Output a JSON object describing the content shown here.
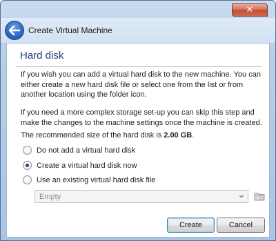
{
  "window": {
    "close_glyph": "✕",
    "title": "Create Virtual Machine"
  },
  "page": {
    "heading": "Hard disk",
    "paragraph1": "If you wish you can add a virtual hard disk to the new machine. You can either create a new hard disk file or select one from the list or from another location using the folder icon.",
    "paragraph2": "If you need a more complex storage set-up you can skip this step and make the changes to the machine settings once the machine is created.",
    "recommended_prefix": "The recommended size of the hard disk is ",
    "recommended_size": "2.00 GB",
    "recommended_suffix": "."
  },
  "options": [
    {
      "label": "Do not add a virtual hard disk",
      "selected": false
    },
    {
      "label": "Create a virtual hard disk now",
      "selected": true
    },
    {
      "label": "Use an existing virtual hard disk file",
      "selected": false
    }
  ],
  "existing_disk": {
    "value": "Empty",
    "enabled": false
  },
  "buttons": {
    "create": "Create",
    "cancel": "Cancel"
  },
  "colors": {
    "heading": "#1f3b79",
    "accent": "#2f6cc4",
    "close": "#c24c32"
  },
  "icons": {
    "back": "back-arrow-icon",
    "close": "close-icon",
    "folder": "folder-icon"
  }
}
